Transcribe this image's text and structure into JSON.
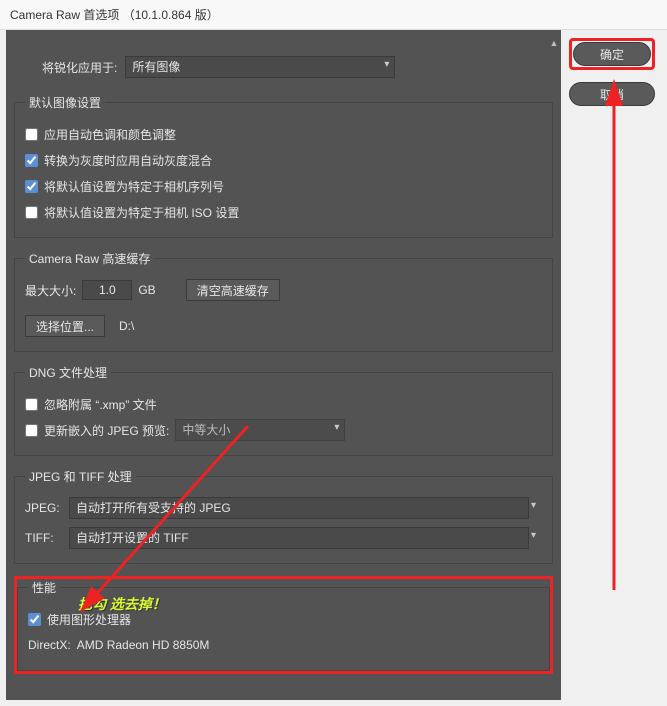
{
  "window": {
    "title": "Camera Raw 首选项 （10.1.0.864 版）"
  },
  "buttons": {
    "ok": "确定",
    "cancel": "取消"
  },
  "sharpen": {
    "label": "将锐化应用于:",
    "value": "所有图像"
  },
  "defaults": {
    "legend": "默认图像设置",
    "cb1": {
      "label": "应用自动色调和颜色调整",
      "checked": false
    },
    "cb2": {
      "label": "转换为灰度时应用自动灰度混合",
      "checked": true
    },
    "cb3": {
      "label": "将默认值设置为特定于相机序列号",
      "checked": true
    },
    "cb4": {
      "label": "将默认值设置为特定于相机 ISO 设置",
      "checked": false
    }
  },
  "cache": {
    "legend": "Camera Raw 高速缓存",
    "maxsize_label": "最大大小:",
    "maxsize_value": "1.0",
    "maxsize_unit": "GB",
    "clear_btn": "清空高速缓存",
    "loc_btn": "选择位置...",
    "loc_path": "D:\\"
  },
  "dng": {
    "legend": "DNG 文件处理",
    "cb1": {
      "label": "忽略附属 “.xmp” 文件",
      "checked": false
    },
    "cb2": {
      "label": "更新嵌入的 JPEG 预览:",
      "checked": false
    },
    "sel": "中等大小"
  },
  "jpegtiff": {
    "legend": "JPEG 和 TIFF 处理",
    "jpeg_label": "JPEG:",
    "jpeg_value": "自动打开所有受支持的 JPEG",
    "tiff_label": "TIFF:",
    "tiff_value": "自动打开设置的 TIFF"
  },
  "perf": {
    "legend": "性能",
    "cb": {
      "label": "使用图形处理器",
      "checked": true
    },
    "dx_label": "DirectX:",
    "dx_value": "AMD Radeon HD 8850M",
    "annotation": "把勾 选去掉！"
  }
}
